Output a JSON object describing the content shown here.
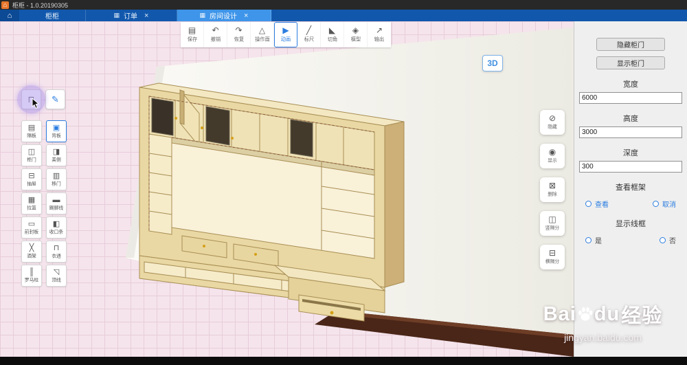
{
  "titlebar": {
    "home_icon": "⌂",
    "title": "柜柜 - 1.0.20190305"
  },
  "tabbar": {
    "home_glyph": "⌂",
    "grid_glyph": "▦",
    "close_glyph": "×",
    "tabs": [
      {
        "label": "柜柜"
      },
      {
        "label": "订单"
      },
      {
        "label": "房间设计"
      }
    ]
  },
  "toolbar": {
    "items": [
      {
        "label": "保存",
        "glyph": "▤"
      },
      {
        "label": "撤销",
        "glyph": "↶"
      },
      {
        "label": "恢复",
        "glyph": "↷"
      },
      {
        "label": "操作面",
        "glyph": "△"
      },
      {
        "label": "动画",
        "glyph": "▶"
      },
      {
        "label": "标尺",
        "glyph": "╱"
      },
      {
        "label": "切角",
        "glyph": "◣"
      },
      {
        "label": "模型",
        "glyph": "◈"
      },
      {
        "label": "输出",
        "glyph": "↗"
      }
    ]
  },
  "left_tools": {
    "top": [
      {
        "name": "shape-tool",
        "glyph": "⊓"
      },
      {
        "name": "draw-tool",
        "glyph": "✎"
      }
    ],
    "items": [
      {
        "label": "隔板",
        "glyph": "▤"
      },
      {
        "label": "背板",
        "glyph": "▣"
      },
      {
        "label": "柜门",
        "glyph": "◫"
      },
      {
        "label": "美侧",
        "glyph": "◨"
      },
      {
        "label": "抽屉",
        "glyph": "⊟"
      },
      {
        "label": "移门",
        "glyph": "▥"
      },
      {
        "label": "拉篮",
        "glyph": "▦"
      },
      {
        "label": "踢脚线",
        "glyph": "▬"
      },
      {
        "label": "前封板",
        "glyph": "▭"
      },
      {
        "label": "收口条",
        "glyph": "◧"
      },
      {
        "label": "酒架",
        "glyph": "╳"
      },
      {
        "label": "衣通",
        "glyph": "⊓"
      },
      {
        "label": "罗马柱",
        "glyph": "║"
      },
      {
        "label": "顶线",
        "glyph": "◹"
      }
    ]
  },
  "float_tools": {
    "items": [
      {
        "label": "隐藏",
        "glyph": "⊘"
      },
      {
        "label": "显示",
        "glyph": "◉"
      },
      {
        "label": "删除",
        "glyph": "⊠"
      },
      {
        "label": "竖隔分",
        "glyph": "◫"
      },
      {
        "label": "横隔分",
        "glyph": "⊟"
      }
    ]
  },
  "viewport": {
    "badge_3d": "3D"
  },
  "right_panel": {
    "hide_doors_btn": "隐藏柜门",
    "show_doors_btn": "显示柜门",
    "fields": [
      {
        "label": "宽度",
        "value": "6000"
      },
      {
        "label": "高度",
        "value": "3000"
      },
      {
        "label": "深度",
        "value": "300"
      }
    ],
    "frame_section": {
      "title": "查看框架",
      "option_a": "查看",
      "option_b": "取消"
    },
    "wire_section": {
      "title": "显示线框",
      "option_a": "是",
      "option_b": "否"
    }
  },
  "watermark": {
    "brand_prefix": "Bai",
    "brand_suffix": "du",
    "brand_cn": "经验",
    "url": "jingyan.baidu.com"
  },
  "colors": {
    "accent_blue": "#2b7de0",
    "tabbar_blue": "#1158ad",
    "active_tab_blue": "#3e95e9",
    "wood": "#e9d8a3"
  }
}
